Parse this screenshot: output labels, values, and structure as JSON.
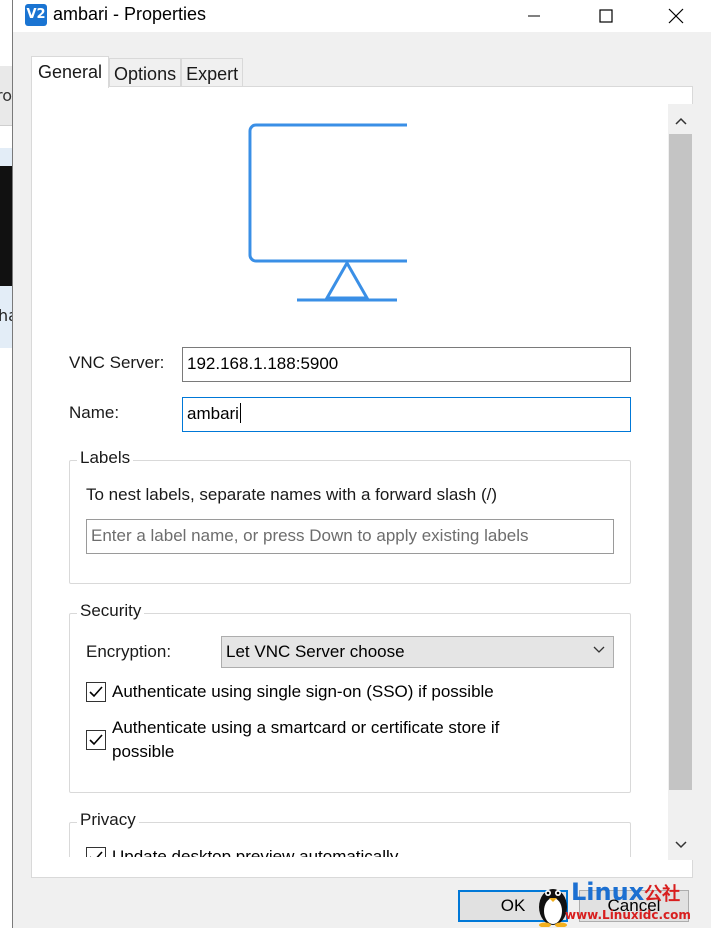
{
  "background_window": {
    "toolbar_text": "ro",
    "thumb_text": "ha"
  },
  "window": {
    "title": "ambari - Properties",
    "app_icon_text": "V2",
    "icons": {
      "app": "vnc-viewer-icon",
      "minimize": "minimize-icon",
      "maximize": "maximize-icon",
      "close": "close-icon"
    }
  },
  "tabs": [
    {
      "label": "General",
      "active": true
    },
    {
      "label": "Options",
      "active": false
    },
    {
      "label": "Expert",
      "active": false
    }
  ],
  "general": {
    "monitor_icon": "monitor-icon",
    "vnc_server_label": "VNC Server:",
    "vnc_server_value": "192.168.1.188:5900",
    "name_label": "Name:",
    "name_value": "ambari"
  },
  "labels_group": {
    "title": "Labels",
    "hint": "To nest labels, separate names with a forward slash (/)",
    "placeholder": "Enter a label name, or press Down to apply existing labels"
  },
  "security_group": {
    "title": "Security",
    "encryption_label": "Encryption:",
    "encryption_value": "Let VNC Server choose",
    "sso_label": "Authenticate using single sign-on (SSO) if possible",
    "sso_checked": true,
    "smartcard_label_line1": "Authenticate using a smartcard or certificate store if",
    "smartcard_label_line2": "possible",
    "smartcard_checked": true
  },
  "privacy_group": {
    "title": "Privacy",
    "preview_label": "Update desktop preview automatically",
    "preview_checked": true
  },
  "buttons": {
    "ok": "OK",
    "cancel": "Cancel"
  },
  "watermark": {
    "brand": "Linux",
    "suffix": "公社",
    "url": "www.Linuxidc.com"
  },
  "colors": {
    "accent": "#0078d7",
    "monitor_stroke": "#3a8fe6",
    "dialog_bg": "#f0f0f0"
  }
}
